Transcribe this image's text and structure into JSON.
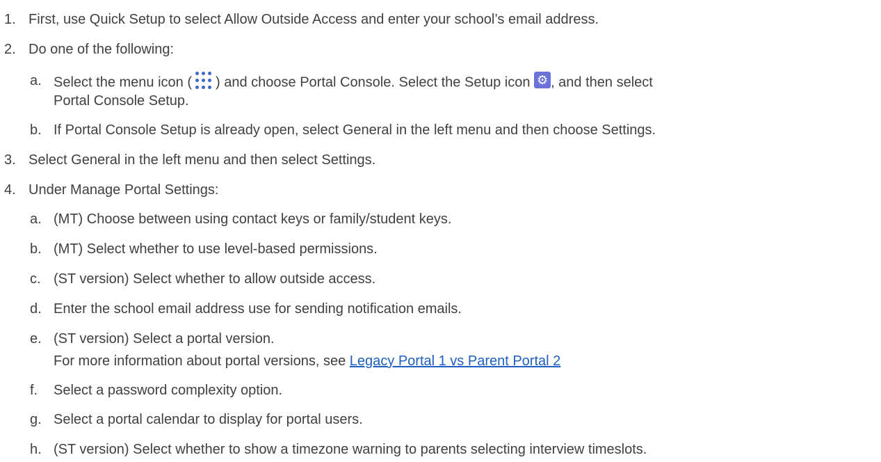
{
  "steps": [
    {
      "num": "1.",
      "text": "First, use Quick Setup to select Allow Outside Access and enter your school’s email address."
    },
    {
      "num": "2.",
      "text": "Do one of the following:"
    },
    {
      "num": "a.",
      "text_pre": "Select the menu icon (",
      "text_mid": ") and choose Portal Console. Select the Setup icon ",
      "text_post": ", and then select",
      "icons": [
        "menu-dots-icon",
        "setup-gear-icon"
      ],
      "accent": "#3b67c9",
      "gear_color": "#6b72d8"
    },
    {
      "num": "",
      "text": "Portal Console Setup."
    },
    {
      "num": "b.",
      "text": "If Portal Console Setup is already open, select General in the left menu and then choose Settings."
    },
    {
      "num": "3.",
      "text": "Select General in the left menu and then select Settings."
    },
    {
      "num": "4.",
      "text": "Under Manage Portal Settings:"
    },
    {
      "num": "a.",
      "text": "(MT) Choose between using contact keys or family/student keys."
    },
    {
      "num": "b.",
      "text": "(MT) Select whether to use level-based permissions."
    },
    {
      "num": "c.",
      "text": "(ST version) Select whether to allow outside access."
    },
    {
      "num": "d.",
      "text": "Enter the school email address use for sending notification emails."
    },
    {
      "num": "e.",
      "text": "(ST version) Select a portal version."
    },
    {
      "num": "",
      "text_pre": "For more information about portal versions, see ",
      "link": "Legacy Portal 1 vs Parent Portal 2",
      "link_color": "#1f5fbf"
    },
    {
      "num": "f.",
      "text": "Select a password complexity option."
    },
    {
      "num": "g.",
      "text": "Select a portal calendar to display for portal users."
    },
    {
      "num": "h.",
      "text": "(ST version) Select whether to show a timezone warning to parents selecting interview timeslots."
    }
  ]
}
